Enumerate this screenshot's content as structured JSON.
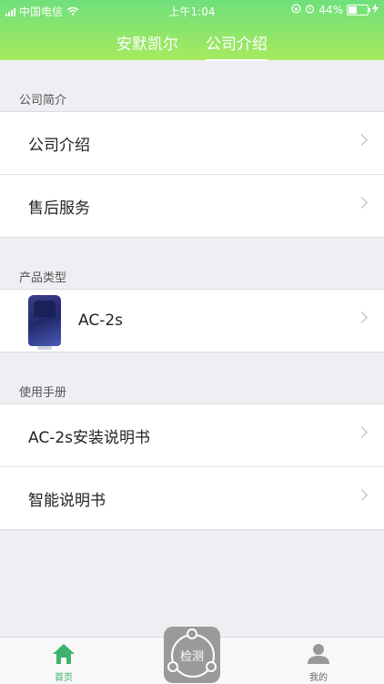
{
  "status_bar": {
    "carrier": "中国电信",
    "time": "上午1:04",
    "battery_percent": "44%",
    "battery_level": 0.44
  },
  "top_tabs": [
    {
      "label": "安默凯尔",
      "active": false
    },
    {
      "label": "公司介绍",
      "active": true
    }
  ],
  "sections": [
    {
      "title": "公司简介",
      "rows": [
        {
          "label": "公司介绍"
        },
        {
          "label": "售后服务"
        }
      ]
    },
    {
      "title": "产品类型",
      "rows": [
        {
          "label": "AC-2s",
          "icon": "car-seat-product-image"
        }
      ]
    },
    {
      "title": "使用手册",
      "rows": [
        {
          "label": "AC-2s安装说明书"
        },
        {
          "label": "智能说明书"
        }
      ]
    }
  ],
  "tab_bar": {
    "home_label": "首页",
    "center_label": "检测",
    "me_label": "我的"
  },
  "colors": {
    "header_top": "#6fe07b",
    "header_bottom": "#a7ea5f",
    "accent_green": "#3eb26b",
    "center_button": "#9a9a9a"
  }
}
